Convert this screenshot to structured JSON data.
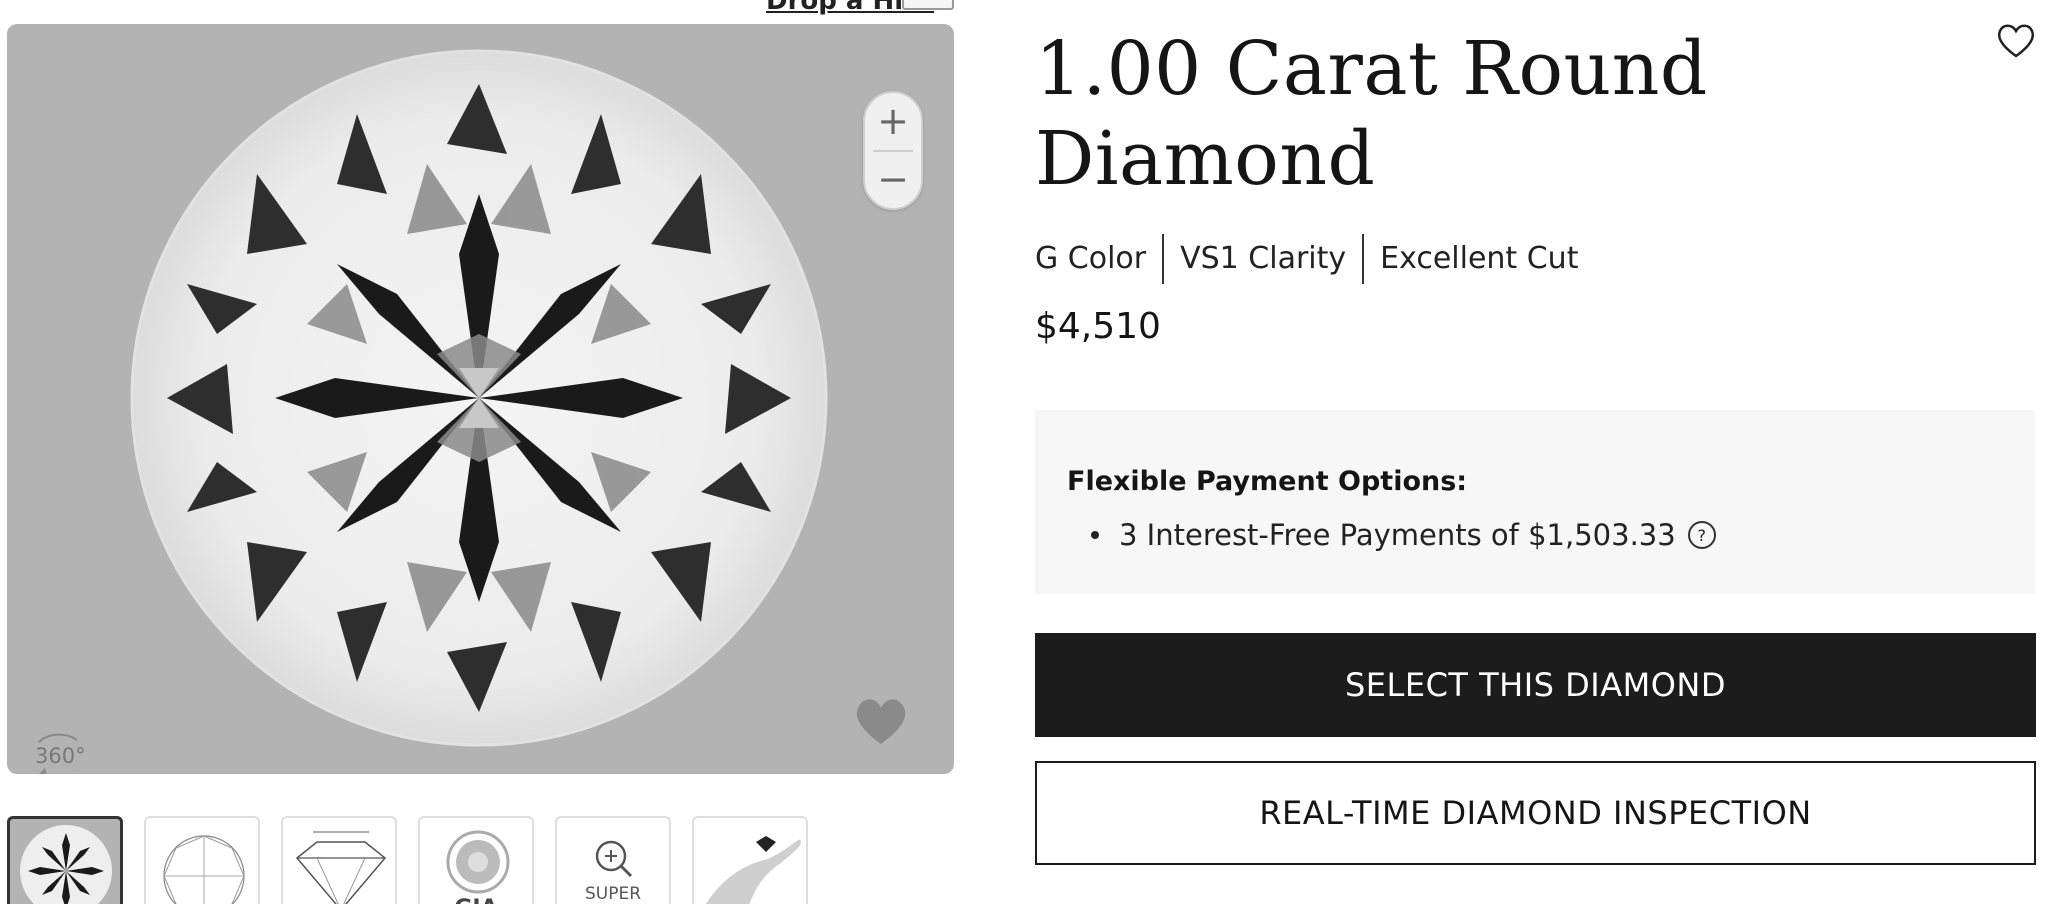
{
  "top": {
    "link_text": "Drop a Hint"
  },
  "viewer": {
    "zoom_in": "+",
    "zoom_out": "−",
    "rotate_label": "360°"
  },
  "thumbnails": [
    {
      "name": "diamond-photo",
      "label": ""
    },
    {
      "name": "top-diagram",
      "label": ""
    },
    {
      "name": "profile-diagram",
      "label": ""
    },
    {
      "name": "gia-certificate",
      "label": "GIA"
    },
    {
      "name": "super-zoom",
      "label": "SUPER"
    },
    {
      "name": "hand-size",
      "label": ""
    }
  ],
  "product": {
    "title_line1": "1.00 Carat Round",
    "title_line2": "Diamond",
    "specs": [
      "G Color",
      "VS1 Clarity",
      "Excellent Cut"
    ],
    "price": "$4,510"
  },
  "payment": {
    "title": "Flexible Payment Options:",
    "item": "3 Interest-Free Payments of $1,503.33",
    "help": "?"
  },
  "actions": {
    "select_label": "SELECT THIS DIAMOND",
    "inspect_label": "REAL-TIME DIAMOND INSPECTION"
  },
  "colors": {
    "button_dark": "#1c1c1c",
    "viewer_bg": "#b3b3b3",
    "payment_bg": "#f7f7f7"
  }
}
